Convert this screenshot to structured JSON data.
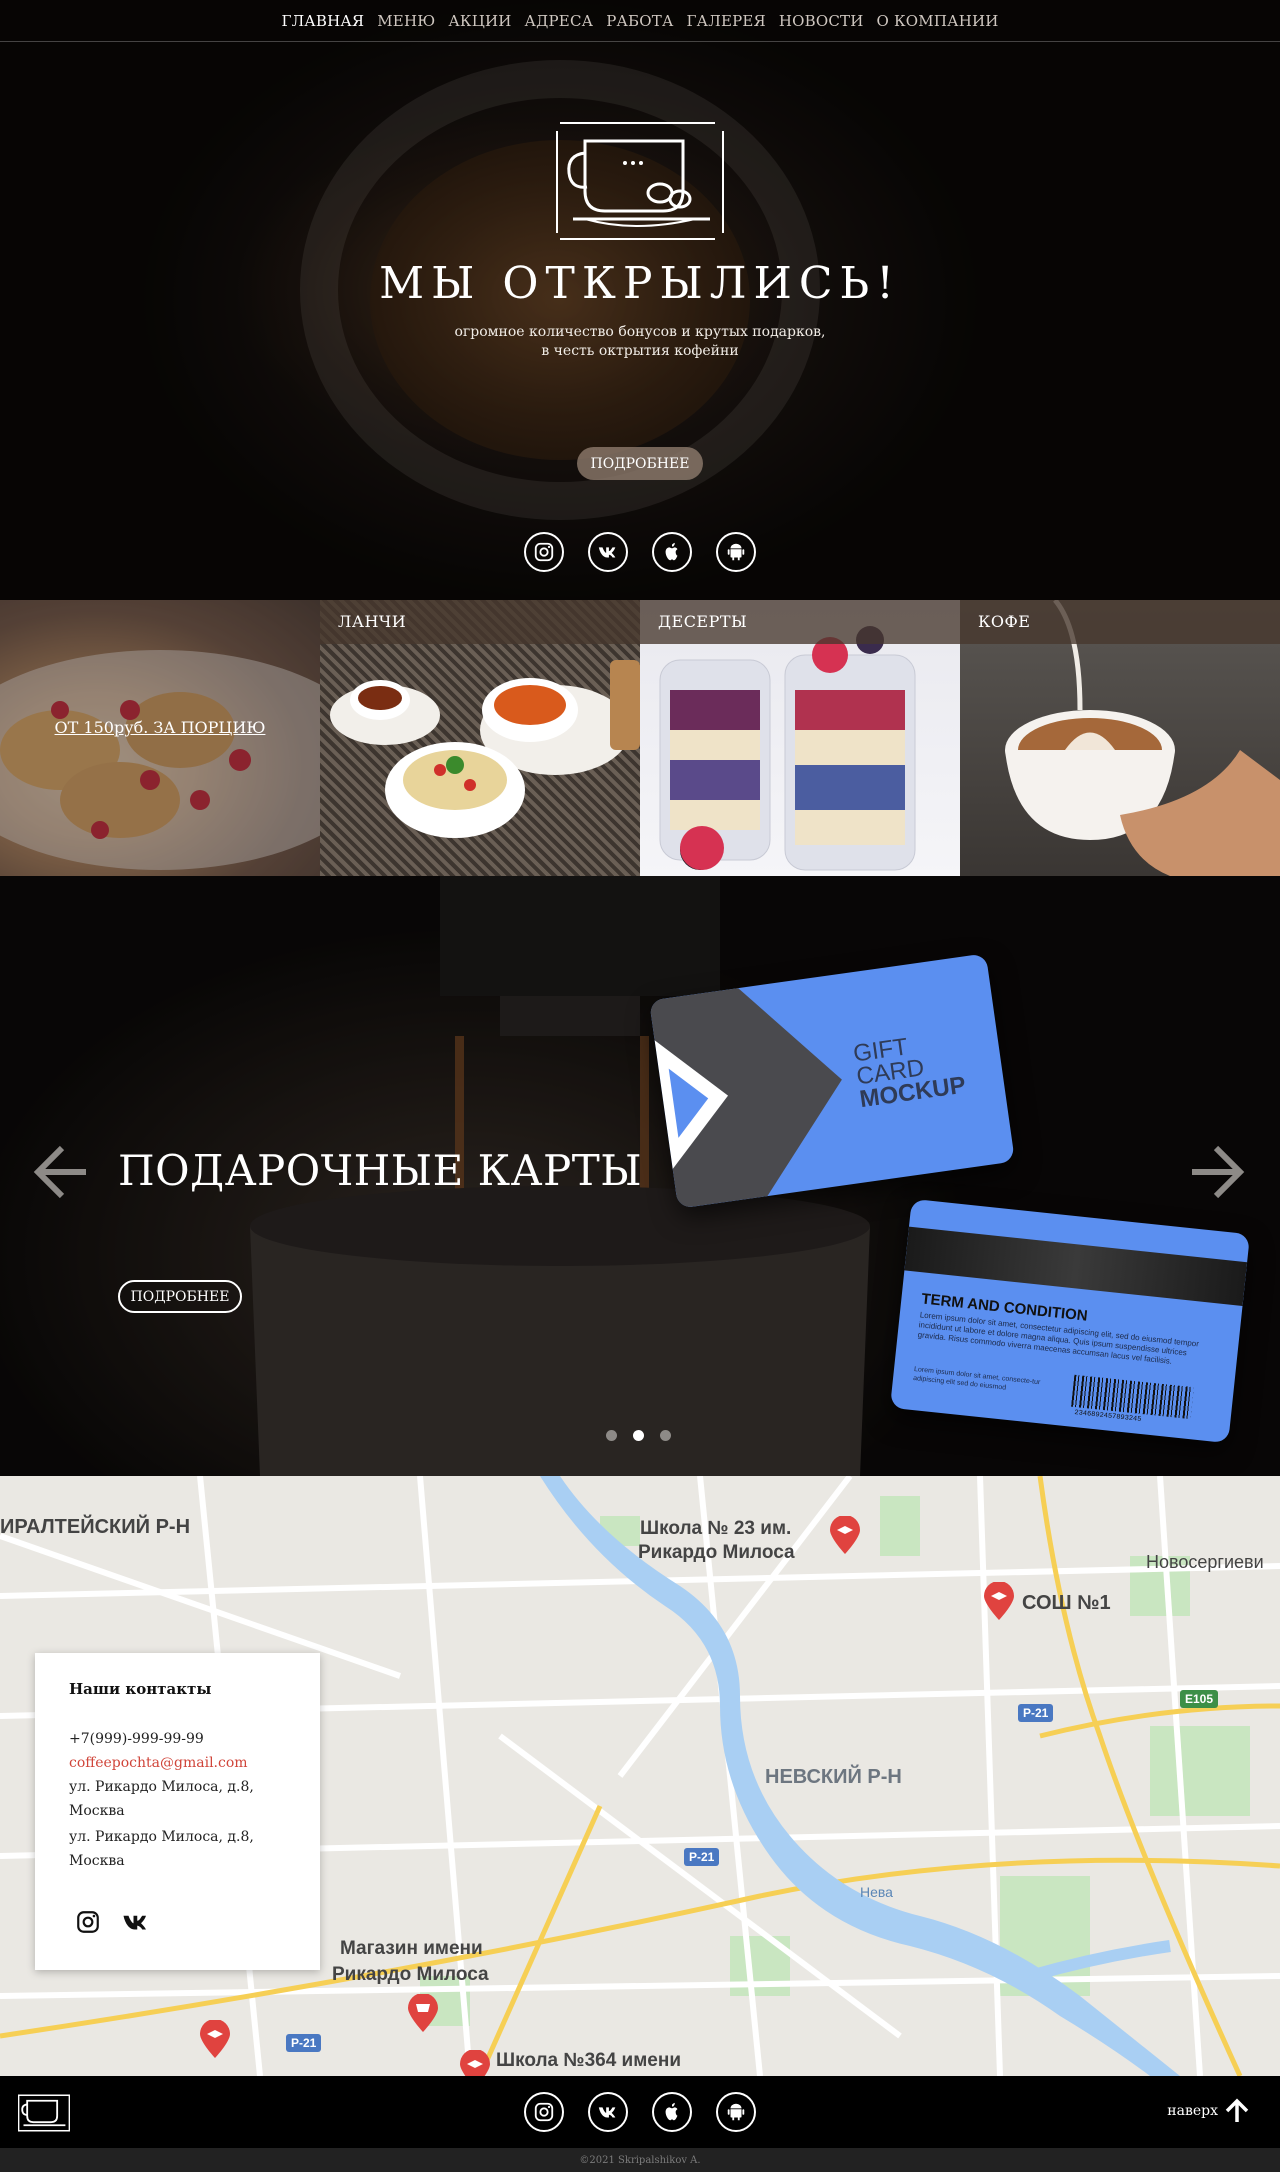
{
  "nav": {
    "items": [
      "ГЛАВНАЯ",
      "МЕНЮ",
      "АКЦИИ",
      "АДРЕСА",
      "РАБОТА",
      "ГАЛЕРЕЯ",
      "НОВОСТИ",
      "О КОМПАНИИ"
    ],
    "active_index": 0
  },
  "hero": {
    "title": "МЫ ОТКРЫЛИСЬ!",
    "subtitle_line1": "огромное количество бонусов и крутых подарков,",
    "subtitle_line2": "в честь октрытия кофейни",
    "button": "ПОДРОБНЕЕ",
    "social_icons": [
      "instagram-icon",
      "vk-icon",
      "apple-icon",
      "android-icon"
    ]
  },
  "tiles": [
    {
      "label": "",
      "caption": "ОТ 150руб. ЗА ПОРЦИЮ"
    },
    {
      "label": "ЛАНЧИ",
      "caption": ""
    },
    {
      "label": "ДЕСЕРТЫ",
      "caption": ""
    },
    {
      "label": "КОФЕ",
      "caption": ""
    }
  ],
  "slider": {
    "title": "ПОДАРОЧНЫЕ КАРТЫ",
    "button": "ПОДРОБНЕЕ",
    "dots": 3,
    "active_dot": 1,
    "card_front": {
      "line1": "GIFT",
      "line2": "CARD",
      "line3": "MOCKUP"
    },
    "card_back": {
      "title": "TERM AND CONDITION",
      "body": "Lorem ipsum dolor sit amet, consectetur adipiscing elit, sed do eiusmod tempor incididunt ut labore et dolore magna aliqua. Quis ipsum suspendisse ultrices gravida. Risus commodo viverra maecenas accumsan lacus vel facilisis.",
      "footer": "Lorem ipsum dolor sit amet, consecte-tur adipiscing elit sed do eiusmod",
      "barcode_number": "2346892457893245"
    }
  },
  "map": {
    "labels": [
      "ИРАЛТЕЙСКИЙ Р-Н",
      "Школа № 23 им.",
      "Рикардо Милоса",
      "Новосергиеви",
      "СОШ №1",
      "НЕВСКИЙ Р-Н",
      "Нева",
      "Магазин имени",
      "Рикардо Милоса",
      "Школа №364 имени"
    ],
    "roads": [
      "P-21",
      "E105",
      "P-21",
      "P-21"
    ]
  },
  "contacts": {
    "title": "Наши контакты",
    "phone": "+7(999)-999-99-99",
    "email": "coffeepochta@gmail.com",
    "address1_line1": "ул. Рикардо Милоса, д.8,",
    "address1_line2": "Москва",
    "address2_line1": "ул. Рикардо Милоса, д.8,",
    "address2_line2": "Москва"
  },
  "footer": {
    "up_label": "наверх",
    "copyright": "©2021 Skripalshikov A."
  },
  "colors": {
    "accent_red": "#d0453a",
    "card_blue": "#5b8ff0"
  }
}
